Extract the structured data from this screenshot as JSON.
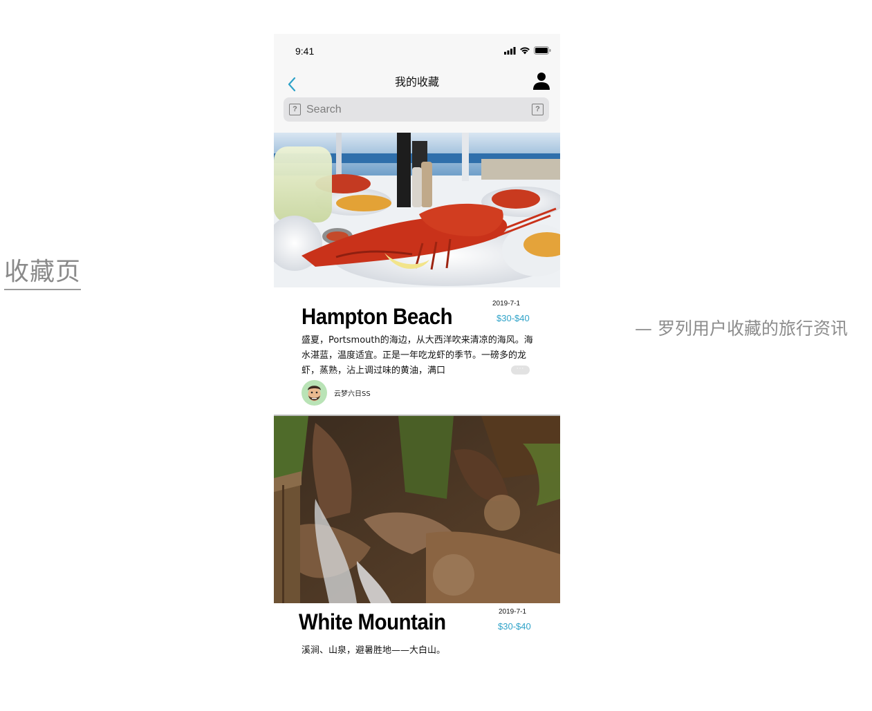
{
  "annotation": {
    "page_label": "收藏页",
    "description": "— 罗列用户收藏的旅行资讯"
  },
  "status_bar": {
    "time": "9:41"
  },
  "nav": {
    "title": "我的收藏",
    "back_icon": "chevron-left-icon",
    "user_icon": "user-icon"
  },
  "search": {
    "placeholder": "Search",
    "left_icon": "question-box-icon",
    "right_icon": "question-box-icon"
  },
  "favorites": [
    {
      "title": "Hampton Beach",
      "date": "2019-7-1",
      "price": "$30-$40",
      "description": "盛夏，Portsmouth的海边，从大西洋吹来清凉的海风。海水湛蓝，温度适宜。正是一年吃龙虾的季节。一磅多的龙虾，蒸熟，沾上调过味的黄油，满口",
      "more": "···",
      "author": "云梦六日SS",
      "image": "lobster-dinner-photo"
    },
    {
      "title": "White Mountain",
      "date": "2019-7-1",
      "price": "$30-$40",
      "description": "溪涧、山泉，避暑胜地——大白山。",
      "more": "···",
      "image": "mountain-stream-photo"
    }
  ],
  "colors": {
    "accent": "#2ea2c8",
    "topbar_bg": "#f7f7f7",
    "search_bg": "#e3e3e5",
    "annotation_text": "#8c8c8c"
  }
}
